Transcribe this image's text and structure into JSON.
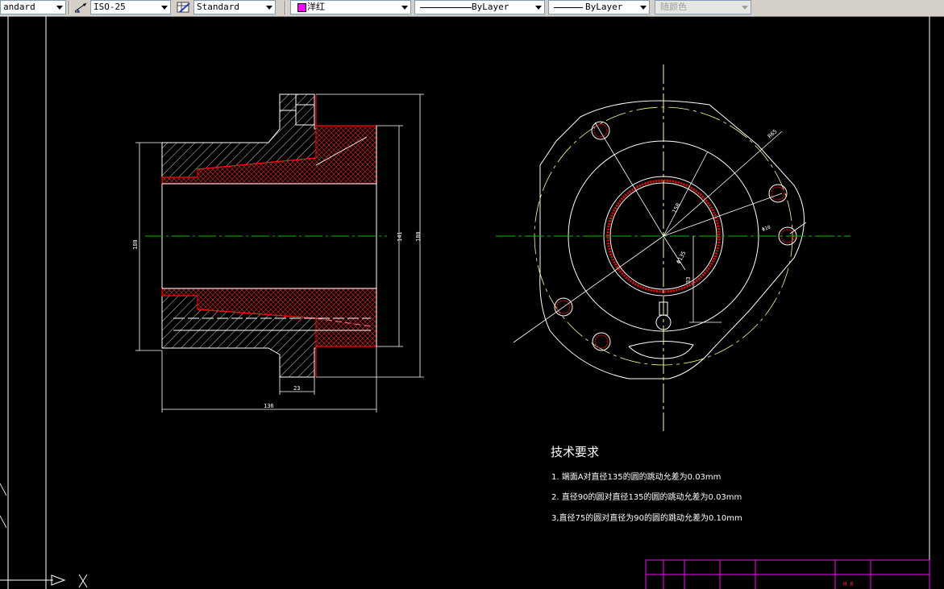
{
  "toolbar": {
    "text_style": "andard",
    "dim_style": "ISO-25",
    "table_style": "Standard",
    "layer_color_name": "洋红",
    "layer_color": "#ff00ff",
    "linetype": "ByLayer",
    "lineweight": "ByLayer",
    "plot_style": "随颜色"
  },
  "dimensions": {
    "left_height": "180",
    "inner_height": "141",
    "outer_height": "180",
    "flange_width": "23",
    "total_length": "136",
    "radius_r": "R65",
    "d150": "150",
    "d135": "Φ135",
    "d33": "33",
    "d10": "Φ10"
  },
  "tech_requirements": {
    "heading": "技术要求",
    "items": [
      "1. 端面A对直径135的圆的跳动允差为0.03mm",
      "2. 直径90的圆对直径135的圆的跳动允差为0.03mm",
      "3,直径75的圆对直径为90的圆的跳动允差为0.10mm"
    ]
  },
  "title_block": {
    "cell_text": "H  8"
  },
  "colors": {
    "background": "#000000",
    "line": "#ffffff",
    "section": "#ff0000",
    "centerline": "#00c000",
    "yellow": "#ffff80"
  }
}
